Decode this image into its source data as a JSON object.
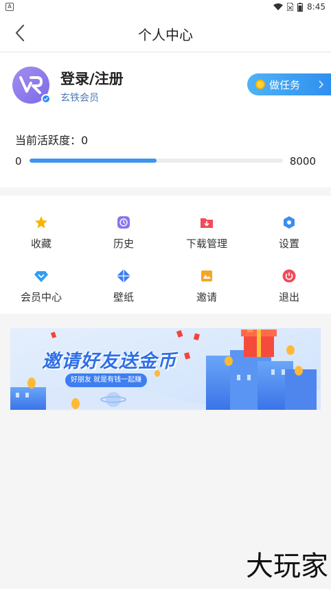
{
  "statusbar": {
    "notification_badge": "A",
    "time": "8:45"
  },
  "header": {
    "title": "个人中心",
    "back_icon": "chevron-left-icon"
  },
  "profile": {
    "login_label": "登录/注册",
    "member_label": "玄铁会员",
    "task_button_label": "做任务",
    "activity_label": "当前活跃度：0",
    "progress_min": "0",
    "progress_max": "8000",
    "progress_fraction": 0.5
  },
  "menu": {
    "items": [
      {
        "label": "收藏",
        "icon": "star-icon",
        "color": "#f7b500"
      },
      {
        "label": "历史",
        "icon": "clock-icon",
        "color": "#8a73ee"
      },
      {
        "label": "下载管理",
        "icon": "download-icon",
        "color": "#f04b5a"
      },
      {
        "label": "设置",
        "icon": "gear-icon",
        "color": "#3d8cf0"
      },
      {
        "label": "会员中心",
        "icon": "diamond-icon",
        "color": "#2e9df4"
      },
      {
        "label": "壁纸",
        "icon": "wallpaper-icon",
        "color": "#3d7ef0"
      },
      {
        "label": "邀请",
        "icon": "invite-icon",
        "color": "#f5a623"
      },
      {
        "label": "退出",
        "icon": "power-icon",
        "color": "#f04b5a"
      }
    ]
  },
  "banner": {
    "title": "邀请好友送金币",
    "subtitle": "好朋友 就是有钱一起赚"
  },
  "watermark": "大玩家",
  "colors": {
    "accent": "#3d95f0",
    "background": "#f5f5f5"
  }
}
